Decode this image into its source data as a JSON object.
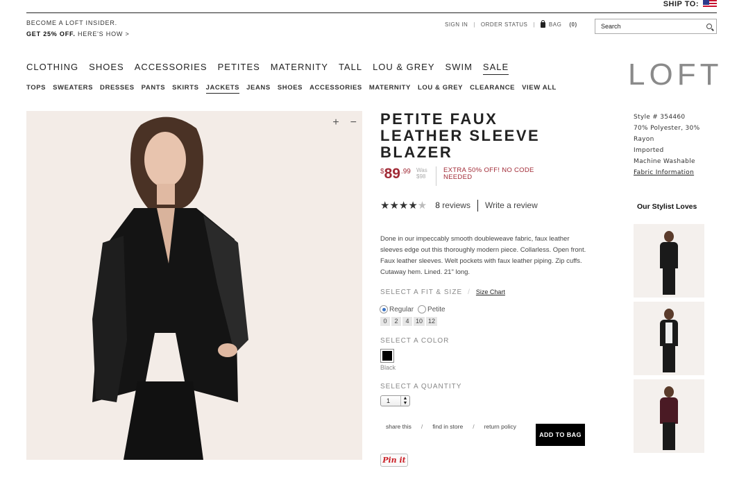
{
  "header": {
    "ship_to_label": "SHIP TO:",
    "insider_line": "BECOME A LOFT INSIDER.",
    "offer_bold": "GET 25% OFF.",
    "offer_link": "HERE'S HOW >",
    "sign_in": "SIGN IN",
    "order_status": "ORDER STATUS",
    "bag_label": "BAG",
    "bag_count": "(0)",
    "search_placeholder": "Search"
  },
  "logo": "LOFT",
  "main_nav": [
    "CLOTHING",
    "SHOES",
    "ACCESSORIES",
    "PETITES",
    "MATERNITY",
    "TALL",
    "LOU & GREY",
    "SWIM",
    "SALE"
  ],
  "main_nav_active": "SALE",
  "sub_nav": [
    "TOPS",
    "SWEATERS",
    "DRESSES",
    "PANTS",
    "SKIRTS",
    "JACKETS",
    "JEANS",
    "SHOES",
    "ACCESSORIES",
    "MATERNITY",
    "LOU & GREY",
    "CLEARANCE",
    "VIEW ALL"
  ],
  "sub_nav_active": "JACKETS",
  "gallery": {
    "zoom_in": "+",
    "zoom_out": "−"
  },
  "product": {
    "title": "PETITE FAUX LEATHER SLEEVE BLAZER",
    "price_currency": "$",
    "price_dollars": "89",
    "price_cents": ".99",
    "was_label": "Was",
    "was_price": "$98",
    "promo": "EXTRA 50% OFF! NO CODE NEEDED",
    "rating": 4.5,
    "stars": "★★★★",
    "half_star": "★",
    "review_count": "8",
    "reviews_label": "reviews",
    "write_review": "Write a review",
    "description": "Done in our impeccably smooth doubleweave fabric, faux leather sleeves edge out this thoroughly modern piece. Collarless. Open front. Faux leather sleeves. Welt pockets with faux leather piping. Zip cuffs. Cutaway hem. Lined. 21\" long.",
    "fit_size_label": "SELECT A FIT & SIZE",
    "size_chart": "Size Chart",
    "fits": [
      "Regular",
      "Petite"
    ],
    "selected_fit": "Regular",
    "sizes": [
      "0",
      "2",
      "4",
      "10",
      "12"
    ],
    "color_label": "SELECT A COLOR",
    "color_name": "Black",
    "color_hex": "#000000",
    "quantity_label": "SELECT A QUANTITY",
    "quantity": "1",
    "share": "share this",
    "find_in_store": "find in store",
    "return_policy": "return policy",
    "add_to_bag": "ADD TO BAG",
    "pin_it": "Pin it"
  },
  "specs": {
    "style": "Style # 354460",
    "fabric_1": "70% Polyester, 30%",
    "fabric_2": "Rayon",
    "origin": "Imported",
    "care": "Machine Washable",
    "fabric_info": "Fabric Information"
  },
  "stylist": {
    "heading": "Our Stylist Loves"
  },
  "colors": {
    "sale_red": "#a12a36",
    "add_to_bag_bg": "#000000"
  }
}
